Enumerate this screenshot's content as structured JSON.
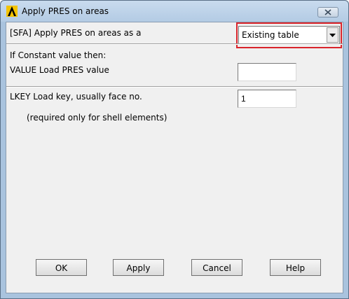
{
  "window": {
    "title": "Apply PRES on areas"
  },
  "form": {
    "sfa_label": "[SFA] Apply PRES on areas as a",
    "sfa_selected": "Existing table",
    "constant_header": "If Constant value then:",
    "value_label": "VALUE  Load PRES value",
    "value_field": "",
    "lkey_label": "LKEY  Load key, usually face no.",
    "lkey_field": "1",
    "lkey_note": "(required only for shell elements)"
  },
  "buttons": {
    "ok": "OK",
    "apply": "Apply",
    "cancel": "Cancel",
    "help": "Help"
  },
  "colors": {
    "highlight": "#d9242b",
    "title_bar": "#b9cfe6"
  }
}
